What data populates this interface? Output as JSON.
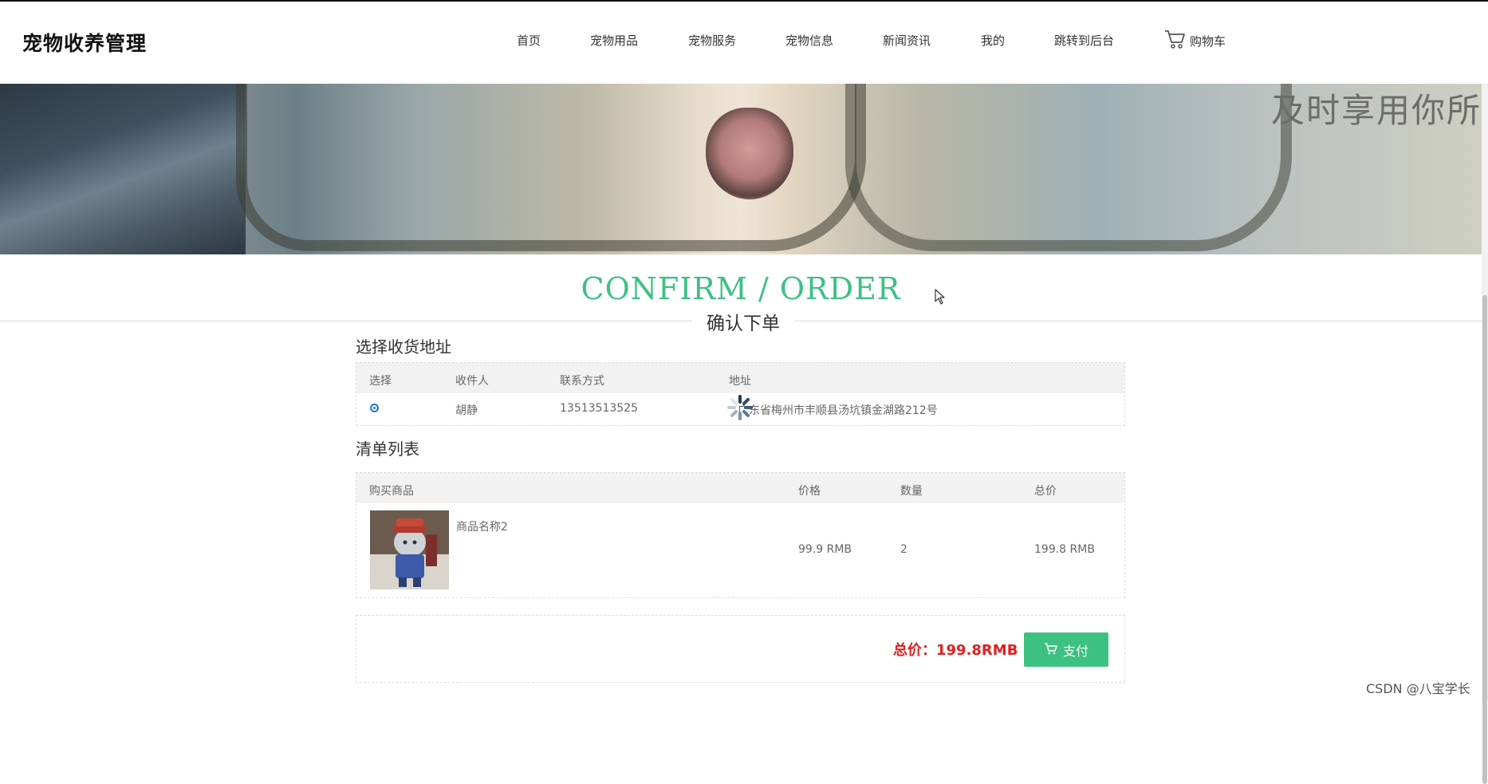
{
  "header": {
    "logo": "宠物收养管理",
    "nav": [
      {
        "label": "首页"
      },
      {
        "label": "宠物用品"
      },
      {
        "label": "宠物服务"
      },
      {
        "label": "宠物信息"
      },
      {
        "label": "新闻资讯"
      },
      {
        "label": "我的"
      },
      {
        "label": "跳转到后台"
      }
    ],
    "cart_label": "购物车",
    "cart_icon": "shopping-cart-icon"
  },
  "banner": {
    "text": "及时享用你所"
  },
  "page": {
    "title_en": "CONFIRM / ORDER",
    "title_cn": "确认下单"
  },
  "address_section": {
    "title": "选择收货地址",
    "columns": [
      "选择",
      "收件人",
      "联系方式",
      "地址"
    ],
    "rows": [
      {
        "selected": true,
        "recipient": "胡静",
        "contact": "13513513525",
        "address": "广东省梅州市丰顺县汤坑镇金湖路212号"
      }
    ]
  },
  "items_section": {
    "title": "清单列表",
    "columns": [
      "购买商品",
      "价格",
      "数量",
      "总价"
    ],
    "rows": [
      {
        "name": "商品名称2",
        "price": "99.9 RMB",
        "quantity": "2",
        "subtotal": "199.8 RMB"
      }
    ]
  },
  "summary": {
    "total_label": "总价：199.8RMB",
    "pay_label": "支付",
    "pay_icon": "shopping-cart-icon"
  },
  "watermark": "CSDN @八宝学长",
  "colors": {
    "accent": "#3cc182",
    "total": "#e02020",
    "radio": "#1a73e8"
  }
}
